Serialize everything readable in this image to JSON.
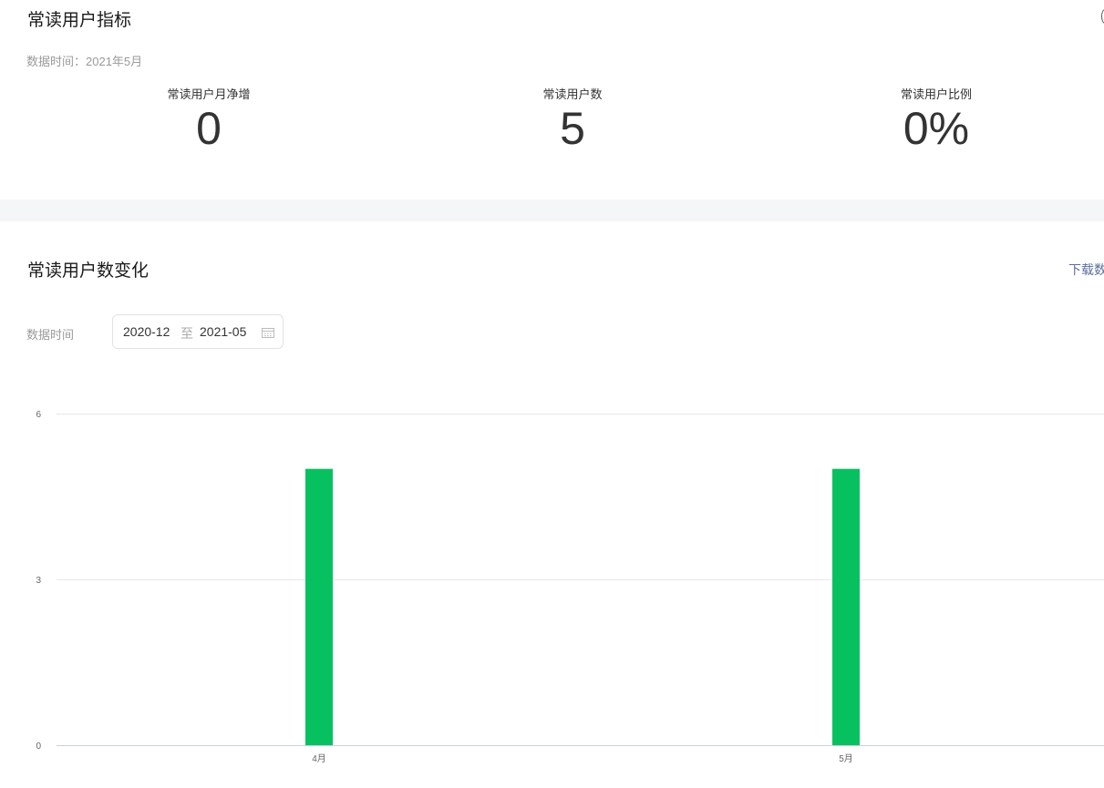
{
  "metrics_section": {
    "title": "常读用户指标",
    "data_time": "数据时间：2021年5月",
    "metrics": [
      {
        "label": "常读用户月净增",
        "value": "0"
      },
      {
        "label": "常读用户数",
        "value": "5"
      },
      {
        "label": "常读用户比例",
        "value": "0%"
      }
    ]
  },
  "trend_section": {
    "title": "常读用户数变化",
    "download_label": "下载数据",
    "filter_label": "数据时间",
    "date_start": "2020-12",
    "date_separator": "至",
    "date_end": "2021-05"
  },
  "chart_data": {
    "type": "bar",
    "categories": [
      "4月",
      "5月"
    ],
    "values": [
      5,
      5
    ],
    "ylim": [
      0,
      6
    ],
    "yticks": [
      "0",
      "3",
      "6"
    ],
    "grid": true,
    "bar_color": "#07c160"
  }
}
